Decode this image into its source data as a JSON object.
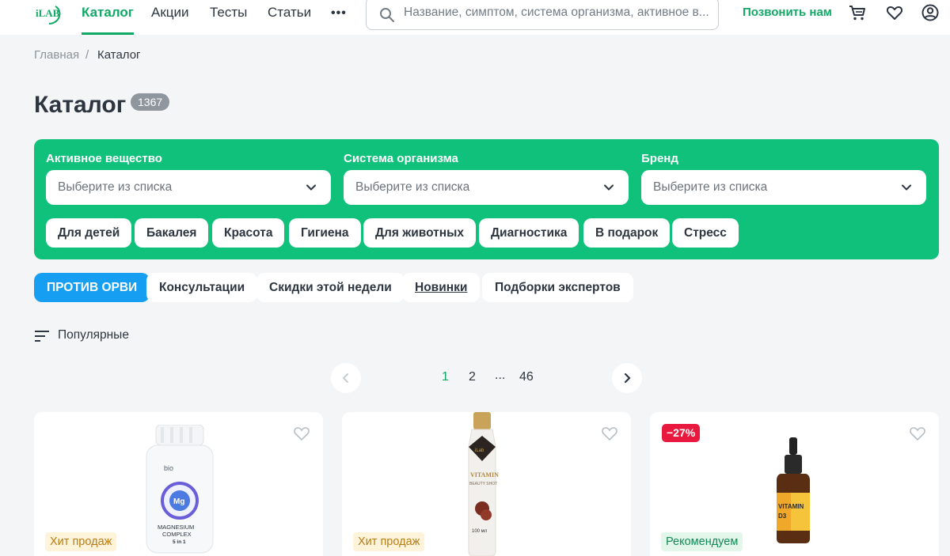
{
  "header": {
    "logo_text": "iLAB",
    "nav": [
      "Каталог",
      "Акции",
      "Тесты",
      "Статьи"
    ],
    "more_label": "•••",
    "search_placeholder": "Название, симптом, система организма, активное в...",
    "call_label": "Позвонить нам"
  },
  "breadcrumb": {
    "home": "Главная",
    "separator": "/",
    "current": "Каталог"
  },
  "page": {
    "title": "Каталог",
    "count": "1367"
  },
  "filters": {
    "fields": [
      {
        "label": "Активное вещество",
        "placeholder": "Выберите из списка"
      },
      {
        "label": "Система организма",
        "placeholder": "Выберите из списка"
      },
      {
        "label": "Бренд",
        "placeholder": "Выберите из списка"
      }
    ],
    "chips": [
      "Для детей",
      "Бакалея",
      "Красота",
      "Гигиена",
      "Для животных",
      "Диагностика",
      "В подарок",
      "Стресс"
    ]
  },
  "tags": [
    "ПРОТИВ ОРВИ",
    "Консультации",
    "Скидки этой недели",
    "Новинки",
    "Подборки экспертов"
  ],
  "sort": {
    "label": "Популярные"
  },
  "pagination": {
    "pages": [
      "1",
      "2",
      "...",
      "46"
    ],
    "current": "1"
  },
  "products": [
    {
      "badge": "Хит продаж",
      "jar_brand": "bio",
      "label_line1": "MAGNESIUM",
      "label_line2": "COMPLEX",
      "label_line3": "5 in 1",
      "mark": "Mg"
    },
    {
      "badge": "Хит продаж",
      "bottle_text": "VITAMIN",
      "bottle_sub": "BEAUTY SHOT",
      "volume": "100 мл"
    },
    {
      "discount": "−27%",
      "badge": "Рекомендуем",
      "bottle_text": "VITAMIN",
      "bottle_sub": "D3"
    }
  ],
  "colors": {
    "accent": "#12a866",
    "filter_bg": "#0fc17a",
    "primary_tag": "#159ef2",
    "discount": "#e8183f"
  }
}
